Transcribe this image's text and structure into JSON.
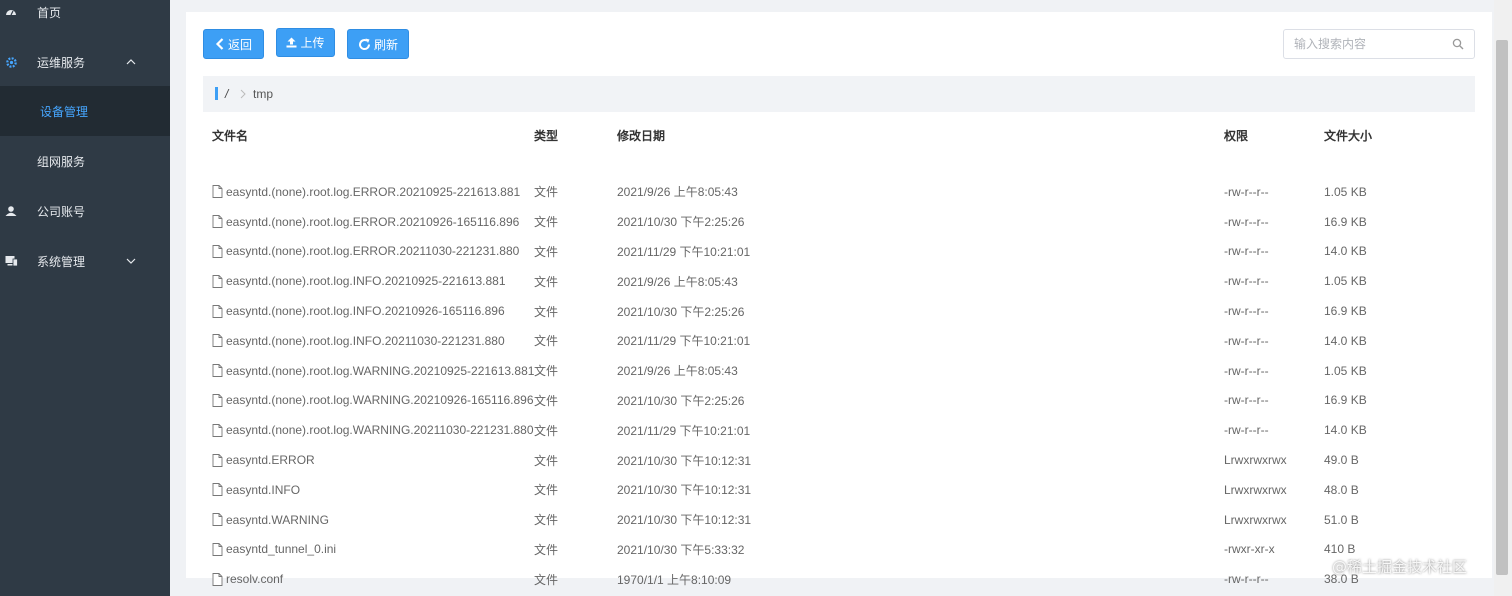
{
  "sidebar": {
    "items": [
      {
        "label": "首页",
        "icon": "dashboard-icon"
      },
      {
        "label": "运维服务",
        "icon": "gear-icon"
      },
      {
        "label": "设备管理",
        "icon": ""
      },
      {
        "label": "组网服务",
        "icon": ""
      },
      {
        "label": "公司账号",
        "icon": "user-icon"
      },
      {
        "label": "系统管理",
        "icon": "computer-icon"
      }
    ]
  },
  "toolbar": {
    "back_label": "返回",
    "upload_label": "上传",
    "refresh_label": "刷新"
  },
  "search": {
    "placeholder": "输入搜索内容"
  },
  "breadcrumb": {
    "root": "/",
    "current": "tmp"
  },
  "table": {
    "headers": [
      "文件名",
      "类型",
      "修改日期",
      "权限",
      "文件大小"
    ],
    "rows": [
      [
        "easyntd.(none).root.log.ERROR.20210925-221613.881",
        "文件",
        "2021/9/26 上午8:05:43",
        "-rw-r--r--",
        "1.05 KB"
      ],
      [
        "easyntd.(none).root.log.ERROR.20210926-165116.896",
        "文件",
        "2021/10/30 下午2:25:26",
        "-rw-r--r--",
        "16.9 KB"
      ],
      [
        "easyntd.(none).root.log.ERROR.20211030-221231.880",
        "文件",
        "2021/11/29 下午10:21:01",
        "-rw-r--r--",
        "14.0 KB"
      ],
      [
        "easyntd.(none).root.log.INFO.20210925-221613.881",
        "文件",
        "2021/9/26 上午8:05:43",
        "-rw-r--r--",
        "1.05 KB"
      ],
      [
        "easyntd.(none).root.log.INFO.20210926-165116.896",
        "文件",
        "2021/10/30 下午2:25:26",
        "-rw-r--r--",
        "16.9 KB"
      ],
      [
        "easyntd.(none).root.log.INFO.20211030-221231.880",
        "文件",
        "2021/11/29 下午10:21:01",
        "-rw-r--r--",
        "14.0 KB"
      ],
      [
        "easyntd.(none).root.log.WARNING.20210925-221613.881",
        "文件",
        "2021/9/26 上午8:05:43",
        "-rw-r--r--",
        "1.05 KB"
      ],
      [
        "easyntd.(none).root.log.WARNING.20210926-165116.896",
        "文件",
        "2021/10/30 下午2:25:26",
        "-rw-r--r--",
        "16.9 KB"
      ],
      [
        "easyntd.(none).root.log.WARNING.20211030-221231.880",
        "文件",
        "2021/11/29 下午10:21:01",
        "-rw-r--r--",
        "14.0 KB"
      ],
      [
        "easyntd.ERROR",
        "文件",
        "2021/10/30 下午10:12:31",
        "Lrwxrwxrwx",
        "49.0 B"
      ],
      [
        "easyntd.INFO",
        "文件",
        "2021/10/30 下午10:12:31",
        "Lrwxrwxrwx",
        "48.0 B"
      ],
      [
        "easyntd.WARNING",
        "文件",
        "2021/10/30 下午10:12:31",
        "Lrwxrwxrwx",
        "51.0 B"
      ],
      [
        "easyntd_tunnel_0.ini",
        "文件",
        "2021/10/30 下午5:33:32",
        "-rwxr-xr-x",
        "410 B"
      ],
      [
        "resolv.conf",
        "文件",
        "1970/1/1 上午8:10:09",
        "-rw-r--r--",
        "38.0 B"
      ]
    ]
  },
  "watermark": "@稀土掘金技术社区",
  "colors": {
    "sidebar_bg": "#2f3a45",
    "sidebar_active_bg": "#222b33",
    "accent": "#3d9ff5",
    "active_text": "#46a6ff"
  }
}
